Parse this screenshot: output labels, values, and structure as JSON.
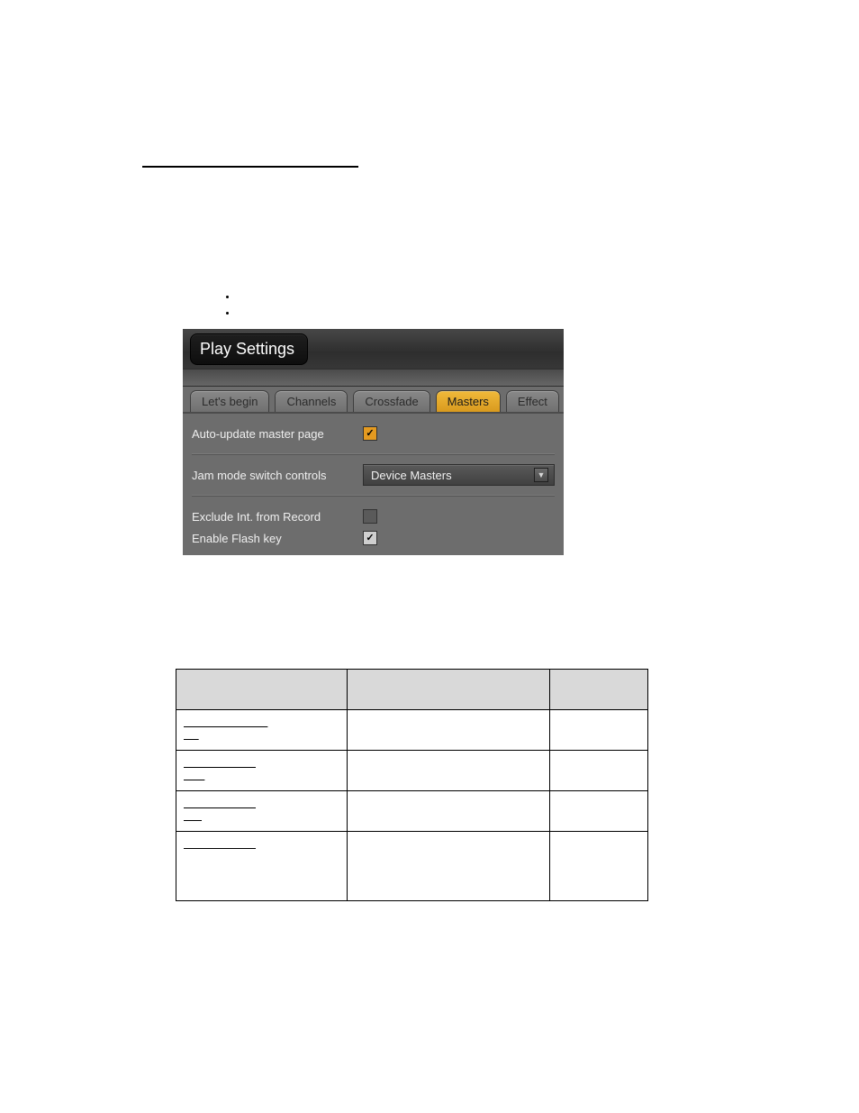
{
  "shot": {
    "title": "Play Settings",
    "tabs": [
      "Let's begin",
      "Channels",
      "Crossfade",
      "Masters",
      "Effect"
    ],
    "active_tab_index": 3,
    "rows": {
      "auto_update": {
        "label": "Auto-update master page",
        "checked": true
      },
      "jam_mode": {
        "label": "Jam mode switch controls",
        "value": "Device Masters"
      },
      "exclude": {
        "label": "Exclude Int. from Record",
        "checked": false
      },
      "flash": {
        "label": "Enable Flash key",
        "checked": true
      }
    }
  },
  "table": {
    "headers": [
      "",
      "",
      ""
    ],
    "rows": [
      {
        "link": ""
      },
      {
        "link": ""
      },
      {
        "link": ""
      },
      {
        "link": ""
      }
    ]
  }
}
